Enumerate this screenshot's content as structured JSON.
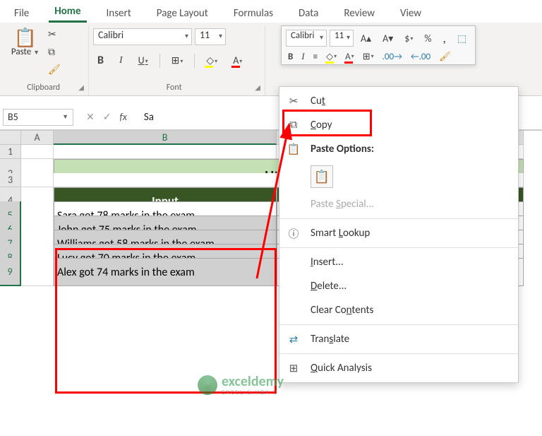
{
  "tabs": [
    "File",
    "Home",
    "Insert",
    "Page Layout",
    "Formulas",
    "Data",
    "Review",
    "View"
  ],
  "active_tab": 1,
  "ribbon": {
    "clipboard_label": "Clipboard",
    "paste_label": "Paste",
    "font_label": "Font",
    "font_name": "Calibri",
    "font_size": "11"
  },
  "mini_toolbar": {
    "font_name": "Calibri",
    "font_size": "11"
  },
  "namebox": "B5",
  "formula_text": "Sa",
  "columns": [
    "A",
    "B"
  ],
  "rows": [
    1,
    2,
    3,
    4,
    5,
    6,
    7,
    8,
    9
  ],
  "title_cell": "Utilizing",
  "input_header": "Input",
  "data": [
    "Sara got 78 marks in the exam",
    "John got 75 marks in the exam",
    "Williams got 58 marks in the exam",
    "Lucy got 70 marks in the exam",
    "Alex got 74 marks in the exam"
  ],
  "context_menu": {
    "cut": "Cut",
    "copy": "Copy",
    "paste_options": "Paste Options:",
    "paste_special": "Paste Special...",
    "smart_lookup": "Smart Lookup",
    "insert": "Insert...",
    "delete": "Delete...",
    "clear": "Clear Contents",
    "translate": "Translate",
    "quick_analysis": "Quick Analysis"
  },
  "watermark": {
    "brand": "exceldemy",
    "tag": "EXCEL & VBA D"
  }
}
